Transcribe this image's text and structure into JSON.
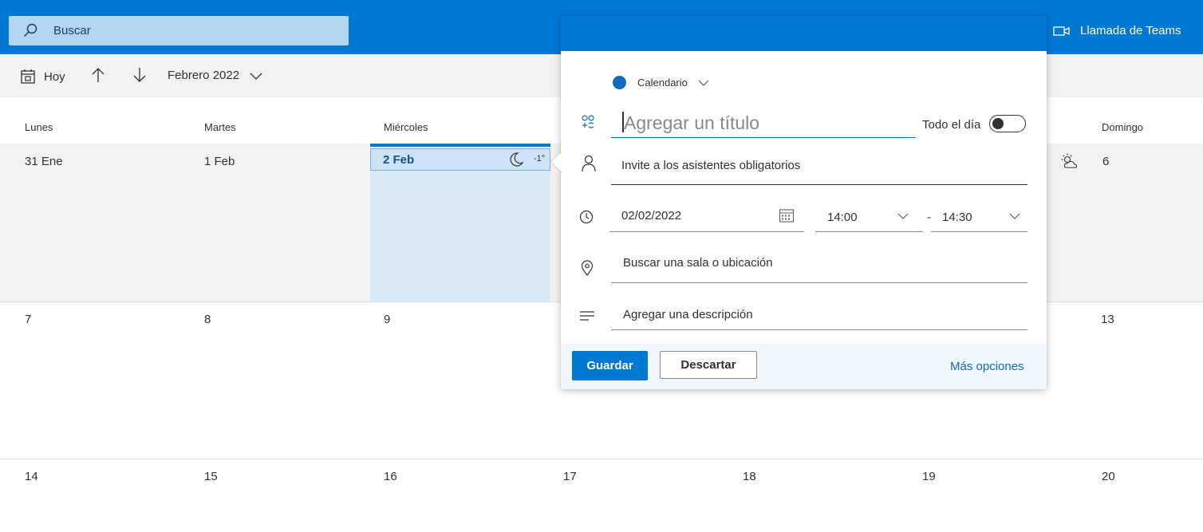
{
  "topbar": {
    "search_label": "Buscar",
    "teams_label": "Llamada de Teams",
    "icons": [
      "search-icon",
      "video-icon"
    ]
  },
  "toolbar": {
    "today_label": "Hoy",
    "month_label": "Febrero 2022",
    "icons": [
      "calendar-today-icon",
      "arrow-up-icon",
      "arrow-down-icon",
      "chevron-down-icon"
    ]
  },
  "calendar": {
    "day_names": [
      "Lunes",
      "Martes",
      "Miércoles",
      "Domingo"
    ],
    "week1": [
      "31 Ene",
      "1 Feb",
      "2 Feb",
      "6"
    ],
    "today_temp": "-1°",
    "week2": [
      "7",
      "8",
      "9",
      "13"
    ],
    "week3": [
      "14",
      "15",
      "16",
      "17",
      "18",
      "19",
      "20"
    ]
  },
  "popup": {
    "calendar_label": "Calendario",
    "calendar_color": "#0f6cbd",
    "title_placeholder": "Agregar un título",
    "all_day_label": "Todo el día",
    "all_day_on": false,
    "attendees_placeholder": "Invite a los asistentes obligatorios",
    "date_value": "02/02/2022",
    "start_time": "14:00",
    "time_separator": "-",
    "end_time": "14:30",
    "location_placeholder": "Buscar una sala o ubicación",
    "description_placeholder": "Agregar una descripción",
    "save_label": "Guardar",
    "discard_label": "Descartar",
    "more_label": "Más opciones"
  },
  "colors": {
    "accent": "#0078d4",
    "today_background": "#dceaf8"
  }
}
